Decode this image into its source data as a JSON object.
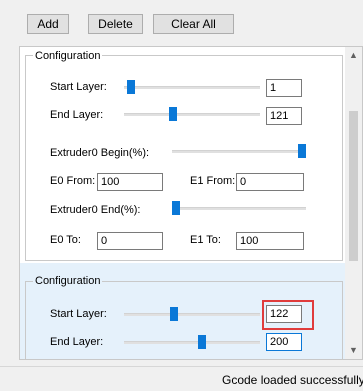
{
  "toolbar": {
    "add_label": "Add",
    "delete_label": "Delete",
    "clear_all_label": "Clear All"
  },
  "groups": [
    {
      "title": "Configuration",
      "start_layer_label": "Start Layer:",
      "start_layer_value": "1",
      "start_layer_slider": 0.02,
      "end_layer_label": "End Layer:",
      "end_layer_value": "121",
      "end_layer_slider": 0.35,
      "extruder0_begin_label": "Extruder0 Begin(%):",
      "extruder0_begin_slider": 1.0,
      "e0_from_label": "E0 From:",
      "e0_from_value": "100",
      "e1_from_label": "E1 From:",
      "e1_from_value": "0",
      "extruder0_end_label": "Extruder0 End(%):",
      "extruder0_end_slider": 0.0,
      "e0_to_label": "E0 To:",
      "e0_to_value": "0",
      "e1_to_label": "E1 To:",
      "e1_to_value": "100"
    },
    {
      "title": "Configuration",
      "start_layer_label": "Start Layer:",
      "start_layer_value": "122",
      "start_layer_slider": 0.36,
      "end_layer_label": "End Layer:",
      "end_layer_value": "200",
      "end_layer_slider": 0.58
    }
  ],
  "colors": {
    "accent": "#0a78d7",
    "highlight_box": "#e03c3c",
    "selected_group_bg": "#e5f1fb"
  },
  "status": {
    "text": "Gcode loaded successfully"
  }
}
